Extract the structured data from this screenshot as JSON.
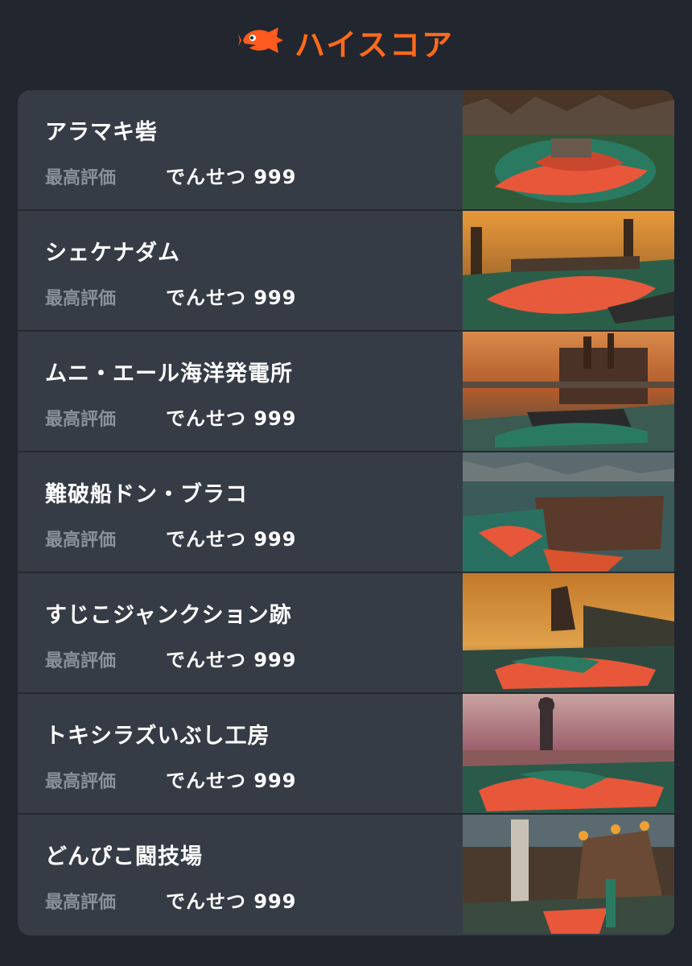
{
  "header": {
    "title": "ハイスコア",
    "icon": "salmon-fish-icon",
    "accent": "#ff6a1a"
  },
  "score_label": "最高評価",
  "stages": [
    {
      "name": "アラマキ砦",
      "score_label": "最高評価",
      "score": "でんせつ 999",
      "scene": "fort"
    },
    {
      "name": "シェケナダム",
      "score_label": "最高評価",
      "score": "でんせつ 999",
      "scene": "dam"
    },
    {
      "name": "ムニ・エール海洋発電所",
      "score_label": "最高評価",
      "score": "でんせつ 999",
      "scene": "plant"
    },
    {
      "name": "難破船ドン・ブラコ",
      "score_label": "最高評価",
      "score": "でんせつ 999",
      "scene": "ship"
    },
    {
      "name": "すじこジャンクション跡",
      "score_label": "最高評価",
      "score": "でんせつ 999",
      "scene": "junction"
    },
    {
      "name": "トキシラズいぶし工房",
      "score_label": "最高評価",
      "score": "でんせつ 999",
      "scene": "smokehouse"
    },
    {
      "name": "どんぴこ闘技場",
      "score_label": "最高評価",
      "score": "でんせつ 999",
      "scene": "arena"
    }
  ]
}
